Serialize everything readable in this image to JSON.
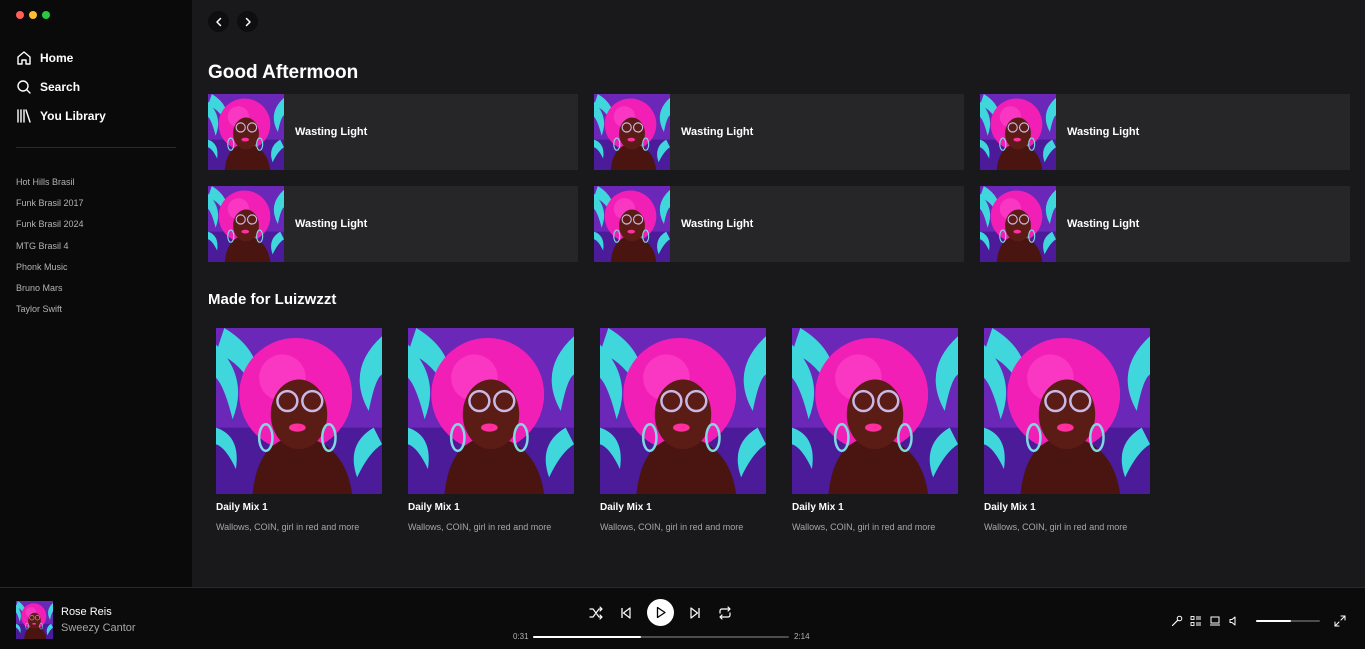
{
  "window": {
    "traffic_colors": [
      "#ff5f57",
      "#febc2e",
      "#28c840"
    ]
  },
  "sidebar": {
    "nav": [
      {
        "label": "Home",
        "icon": "home-icon"
      },
      {
        "label": "Search",
        "icon": "search-icon"
      },
      {
        "label": "You Library",
        "icon": "library-icon"
      }
    ],
    "playlists": [
      "Hot Hills Brasil",
      "Funk Brasil 2017",
      "Funk Brasil 2024",
      "MTG Brasil 4",
      "Phonk Music",
      "Bruno Mars",
      "Taylor Swift"
    ]
  },
  "main": {
    "greeting": "Good Aftermoon",
    "quick_items": [
      {
        "title": "Wasting Light"
      },
      {
        "title": "Wasting Light"
      },
      {
        "title": "Wasting Light"
      },
      {
        "title": "Wasting Light"
      },
      {
        "title": "Wasting Light"
      },
      {
        "title": "Wasting Light"
      }
    ],
    "section_title": "Made for Luizwzzt",
    "mixes": [
      {
        "title": "Daily Mix 1",
        "subtitle": "Wallows, COIN, girl in red and more"
      },
      {
        "title": "Daily Mix 1",
        "subtitle": "Wallows, COIN, girl in red and more"
      },
      {
        "title": "Daily Mix 1",
        "subtitle": "Wallows, COIN, girl in red and more"
      },
      {
        "title": "Daily Mix 1",
        "subtitle": "Wallows, COIN, girl in red and more"
      },
      {
        "title": "Daily Mix 1",
        "subtitle": "Wallows, COIN, girl in red and more"
      }
    ]
  },
  "player": {
    "track_title": "Rose Reis",
    "track_artist": "Sweezy Cantor",
    "time_current": "0:31",
    "time_total": "2:14",
    "progress_fraction": 0.42,
    "volume_fraction": 0.55
  },
  "colors": {
    "cover_pink": "#f21fb6",
    "cover_cyan": "#3fd6dc",
    "cover_purple": "#6a27b8"
  }
}
